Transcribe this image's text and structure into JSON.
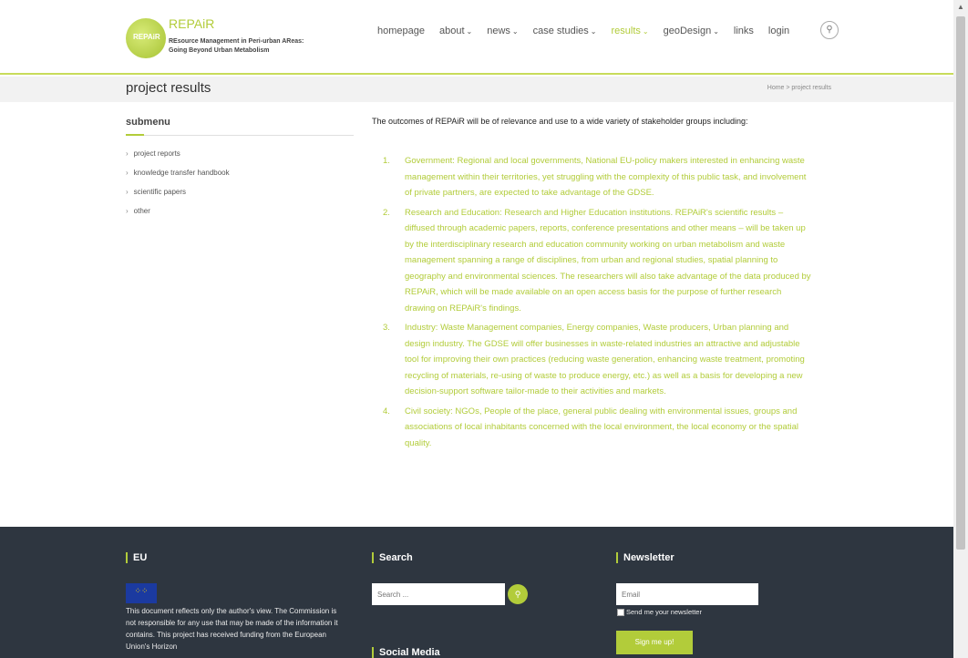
{
  "brand": {
    "name": "REPAiR",
    "logo_text": "REPAiR",
    "tagline_line1": "REsource Management in Peri-urban AReas:",
    "tagline_line2": "Going Beyond Urban Metabolism"
  },
  "nav": {
    "items": [
      {
        "label": "homepage"
      },
      {
        "label": "about",
        "dropdown": true
      },
      {
        "label": "news",
        "dropdown": true
      },
      {
        "label": "case studies",
        "dropdown": true
      },
      {
        "label": "results",
        "dropdown": true,
        "active": true
      },
      {
        "label": "geoDesign",
        "dropdown": true
      },
      {
        "label": "links"
      },
      {
        "label": "login"
      }
    ],
    "search_icon": "search-icon"
  },
  "page": {
    "title": "project results",
    "breadcrumb": "Home  >  project results"
  },
  "sidebar": {
    "title": "submenu",
    "items": [
      {
        "label": "project reports"
      },
      {
        "label": "knowledge transfer handbook"
      },
      {
        "label": "scientific papers"
      },
      {
        "label": "other"
      }
    ]
  },
  "main": {
    "intro": "The outcomes of REPAiR will be of relevance and use to a wide variety of stakeholder groups including:",
    "outcomes": [
      {
        "num": "1.",
        "text": "Government: Regional and local governments, National EU-policy makers interested in enhancing waste management within their territories, yet struggling with the complexity of this public task, and involvement of private partners, are expected to take advantage of the GDSE."
      },
      {
        "num": "2.",
        "text": "Research and Education: Research and Higher Education institutions. REPAiR's scientific results – diffused through academic papers, reports, conference presentations and other means – will be taken up by the interdisciplinary research and education community working on urban metabolism and waste management spanning a range of disciplines, from urban and regional studies, spatial planning to geography and environmental sciences. The researchers will also take advantage of the data produced by REPAiR, which will be made available on an open access basis for the purpose of further research drawing on REPAiR's findings."
      },
      {
        "num": "3.",
        "text": "Industry: Waste Management companies, Energy companies, Waste producers, Urban planning and design industry. The GDSE will offer businesses in waste-related industries an attractive and adjustable tool for improving their own practices (reducing waste generation, enhancing waste treatment, promoting recycling of materials, re-using of waste to produce energy, etc.) as well as a basis for developing a new decision-support software tailor-made to their activities and markets."
      },
      {
        "num": "4.",
        "text": "Civil society: NGOs, People of the place, general public dealing with environmental issues, groups and associations of local inhabitants concerned with the local environment, the local economy or the spatial quality."
      }
    ]
  },
  "footer": {
    "eu_heading": "EU",
    "eu_text": "This document reflects only the author's view. The Commission is not responsible for any use that may be made of the information it contains. This project has received funding from the European Union's Horizon",
    "search_heading": "Search",
    "search_placeholder": "Search ...",
    "social_heading": "Social Media",
    "newsletter_heading": "Newsletter",
    "email_placeholder": "Email",
    "checkbox_label": "Send me your newsletter",
    "signup_label": "Sign me up!"
  },
  "colors": {
    "accent": "#b2cc3a",
    "footer_bg": "#2e3640"
  }
}
